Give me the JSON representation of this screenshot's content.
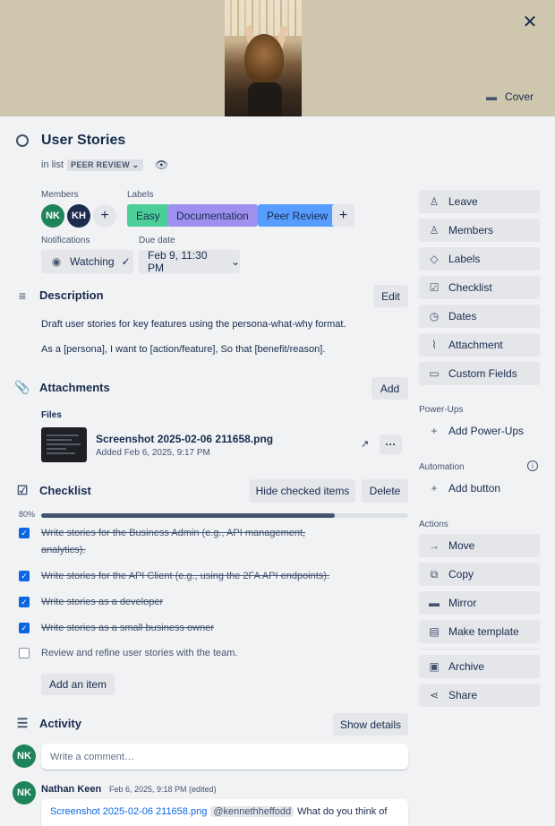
{
  "cover": {
    "button_label": "Cover"
  },
  "card": {
    "title": "User Stories",
    "in_list_prefix": "in list",
    "list_name": "PEER REVIEW"
  },
  "members": {
    "heading": "Members",
    "avatars": [
      {
        "initials": "NK",
        "color": "#1f845a"
      },
      {
        "initials": "KH",
        "color": "#1d2b4f"
      }
    ]
  },
  "labels": {
    "heading": "Labels",
    "items": [
      {
        "name": "Easy",
        "color": "#4bce97"
      },
      {
        "name": "Documentation",
        "color": "#9f8fef"
      },
      {
        "name": "Peer Review",
        "color": "#579dff"
      }
    ]
  },
  "notifications": {
    "heading": "Notifications",
    "button": "Watching"
  },
  "due_date": {
    "heading": "Due date",
    "value": "Feb 9, 11:30 PM"
  },
  "description": {
    "heading": "Description",
    "edit_label": "Edit",
    "line1": "Draft user stories for key features using the persona-what-why format.",
    "line2": "As a [persona], I want to [action/feature], So that [benefit/reason]."
  },
  "attachments": {
    "heading": "Attachments",
    "add_label": "Add",
    "files_heading": "Files",
    "file_name": "Screenshot 2025-02-06 211658.png",
    "file_meta": "Added Feb 6, 2025, 9:17 PM",
    "more": "···"
  },
  "checklist": {
    "heading": "Checklist",
    "hide_label": "Hide checked items",
    "delete_label": "Delete",
    "progress_text": "80%",
    "progress": 0.8,
    "items": [
      {
        "text": "Write stories for the Business Admin (e.g., API management,",
        "text2": "analytics).",
        "checked": true
      },
      {
        "text": "Write stories for the API Client (e.g., using the 2FA API endpoints).",
        "checked": true
      },
      {
        "text": "Write stories as a developer",
        "checked": true
      },
      {
        "text": "Write stories as a small business owner",
        "checked": true
      },
      {
        "text": "Review and refine user stories with the team.",
        "checked": false
      }
    ],
    "add_item_label": "Add an item"
  },
  "activity": {
    "heading": "Activity",
    "show_details_label": "Show details",
    "comment_placeholder": "Write a comment…",
    "user_initials": "NK",
    "entry": {
      "author": "Nathan Keen",
      "timestamp": "Feb 6, 2025, 9:18 PM (edited)",
      "link_text": "Screenshot 2025-02-06 211658.png",
      "mention": "@kennethheffodd",
      "text": "What do you think of"
    }
  },
  "sidebar": {
    "add_to_card": [
      "Leave",
      "Members",
      "Labels",
      "Checklist",
      "Dates",
      "Attachment",
      "Custom Fields"
    ],
    "powerups_heading": "Power-Ups",
    "add_powerups": "Add Power-Ups",
    "automation_heading": "Automation",
    "add_button": "Add button",
    "actions_heading": "Actions",
    "actions": [
      "Move",
      "Copy",
      "Mirror",
      "Make template"
    ],
    "actions2": [
      "Archive",
      "Share"
    ]
  },
  "colors": {
    "accent": "#0c66e4",
    "panel_bg": "#f1f2f4",
    "button_bg": "#e4e6ea",
    "cover_bg": "#cec7ad"
  }
}
